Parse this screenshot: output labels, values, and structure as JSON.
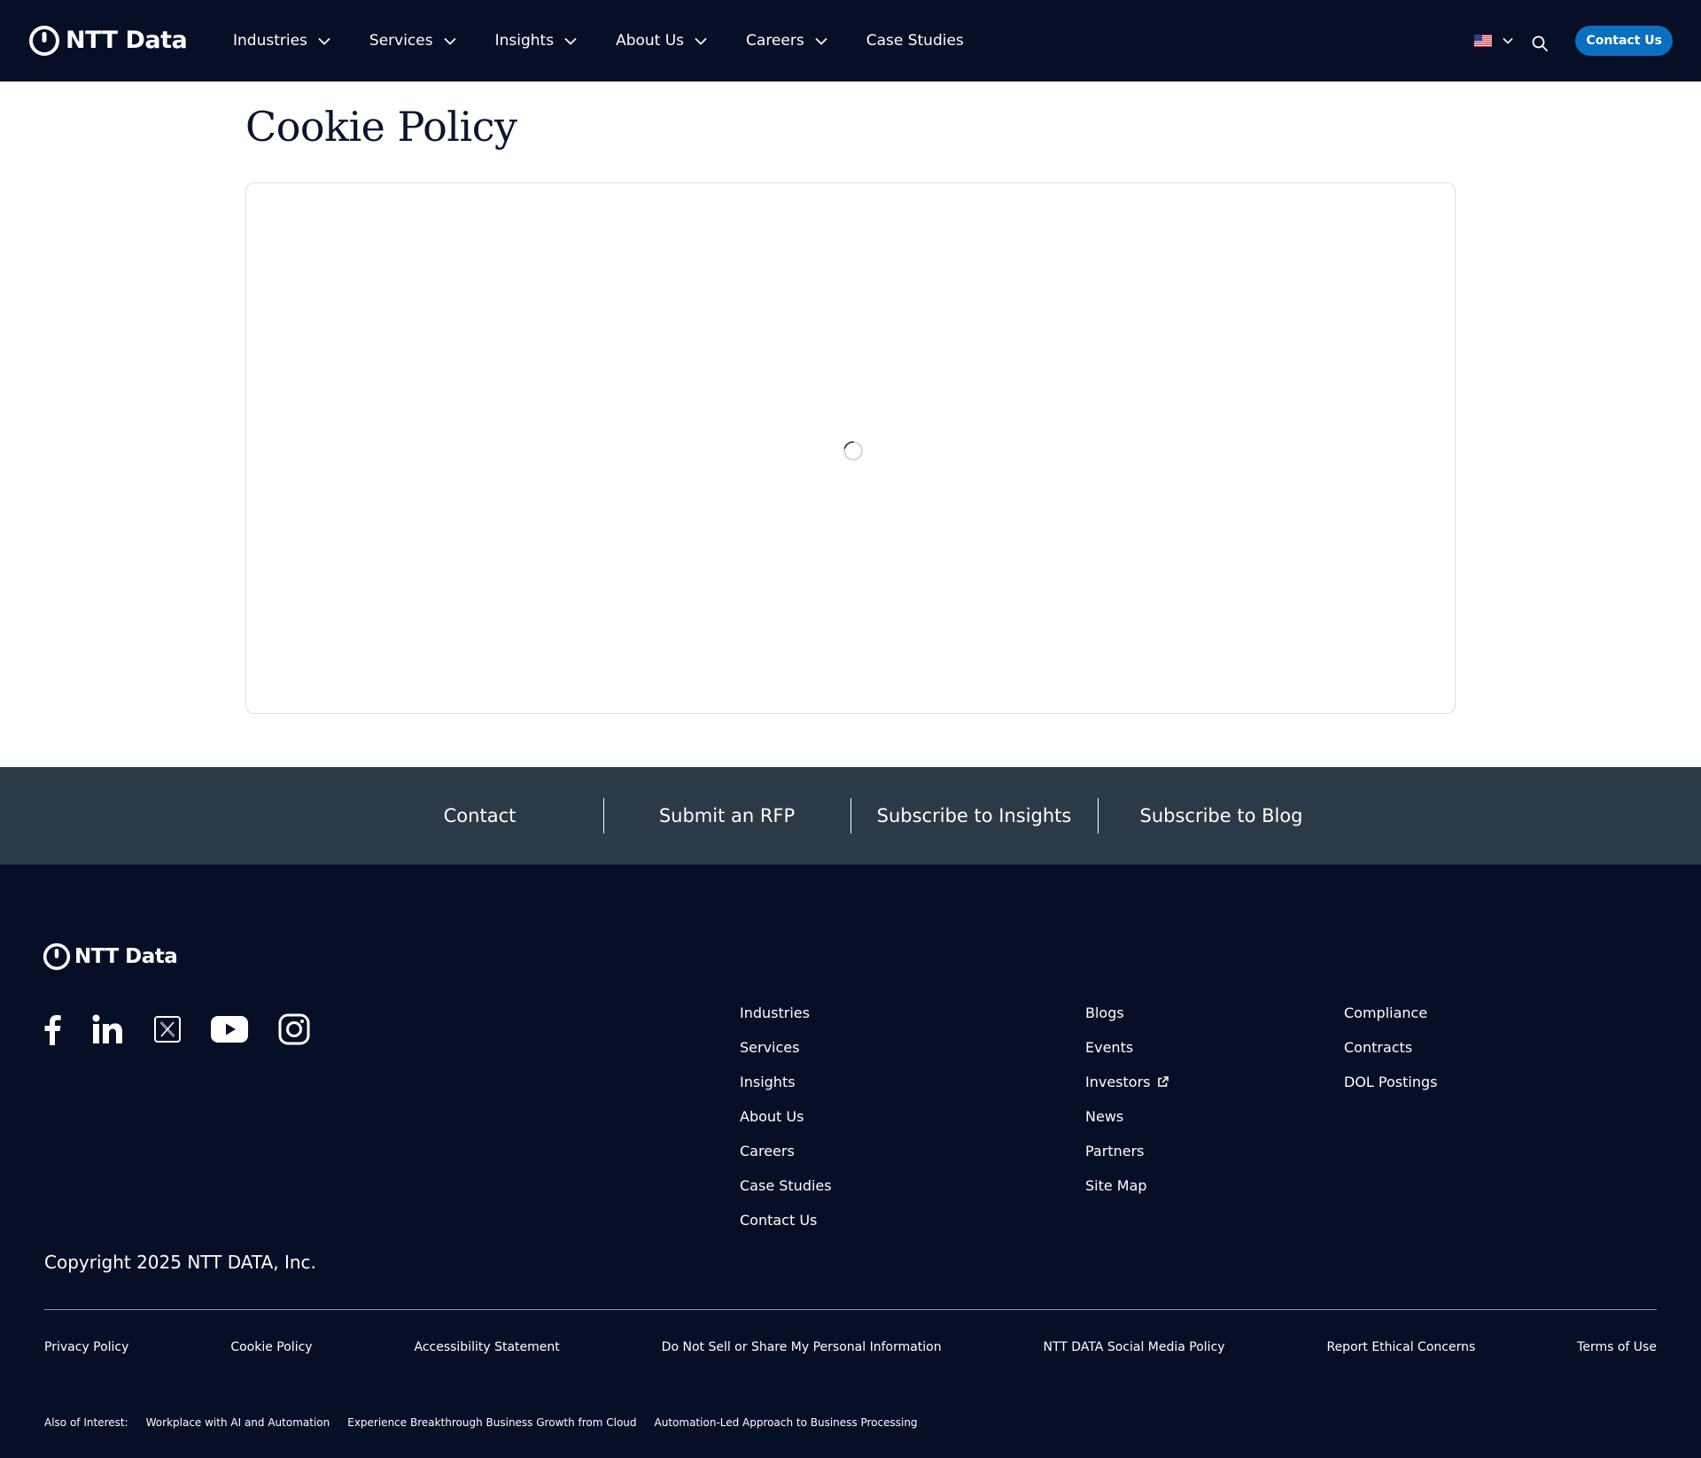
{
  "brand": {
    "name": "NTT DATA",
    "logo_text": "NTT Data"
  },
  "colors": {
    "header_bg": "#070f26",
    "accent": "#0b6fbf",
    "cta_band_bg": "#2b3a46",
    "footer_bg": "#070f26"
  },
  "header": {
    "nav": [
      {
        "label": "Industries",
        "has_menu": true
      },
      {
        "label": "Services",
        "has_menu": true
      },
      {
        "label": "Insights",
        "has_menu": true
      },
      {
        "label": "About Us",
        "has_menu": true
      },
      {
        "label": "Careers",
        "has_menu": true
      },
      {
        "label": "Case Studies",
        "has_menu": false
      }
    ],
    "region_icon": "us-flag-icon",
    "search_icon": "search-icon",
    "contact_label": "Contact Us"
  },
  "main": {
    "title": "Cookie Policy",
    "embed_state": "loading"
  },
  "cta_band": {
    "items": [
      "Contact",
      "Submit an RFP",
      "Subscribe to Insights",
      "Subscribe to Blog"
    ]
  },
  "footer": {
    "social_icons": [
      "facebook-icon",
      "linkedin-icon",
      "x-icon",
      "youtube-icon",
      "instagram-icon"
    ],
    "col1": [
      "Industries",
      "Services",
      "Insights",
      "About Us",
      "Careers",
      "Case Studies",
      "Contact Us"
    ],
    "col2": [
      "Blogs",
      "Events",
      "Investors",
      "News",
      "Partners",
      "Site Map"
    ],
    "col3": [
      "Compliance",
      "Contracts",
      "DOL Postings"
    ],
    "copyright": "Copyright 2025 NTT DATA, Inc.",
    "legal": [
      "Privacy Policy",
      "Cookie Policy",
      "Accessibility Statement",
      "Do Not Sell or Share My Personal Information",
      "NTT DATA Social Media Policy",
      "Report Ethical Concerns",
      "Terms of Use"
    ],
    "also_label": "Also of Interest:",
    "also_links": [
      "Workplace with AI and Automation",
      "Experience Breakthrough Business Growth from Cloud",
      "Automation-Led Approach to Business Processing"
    ]
  }
}
